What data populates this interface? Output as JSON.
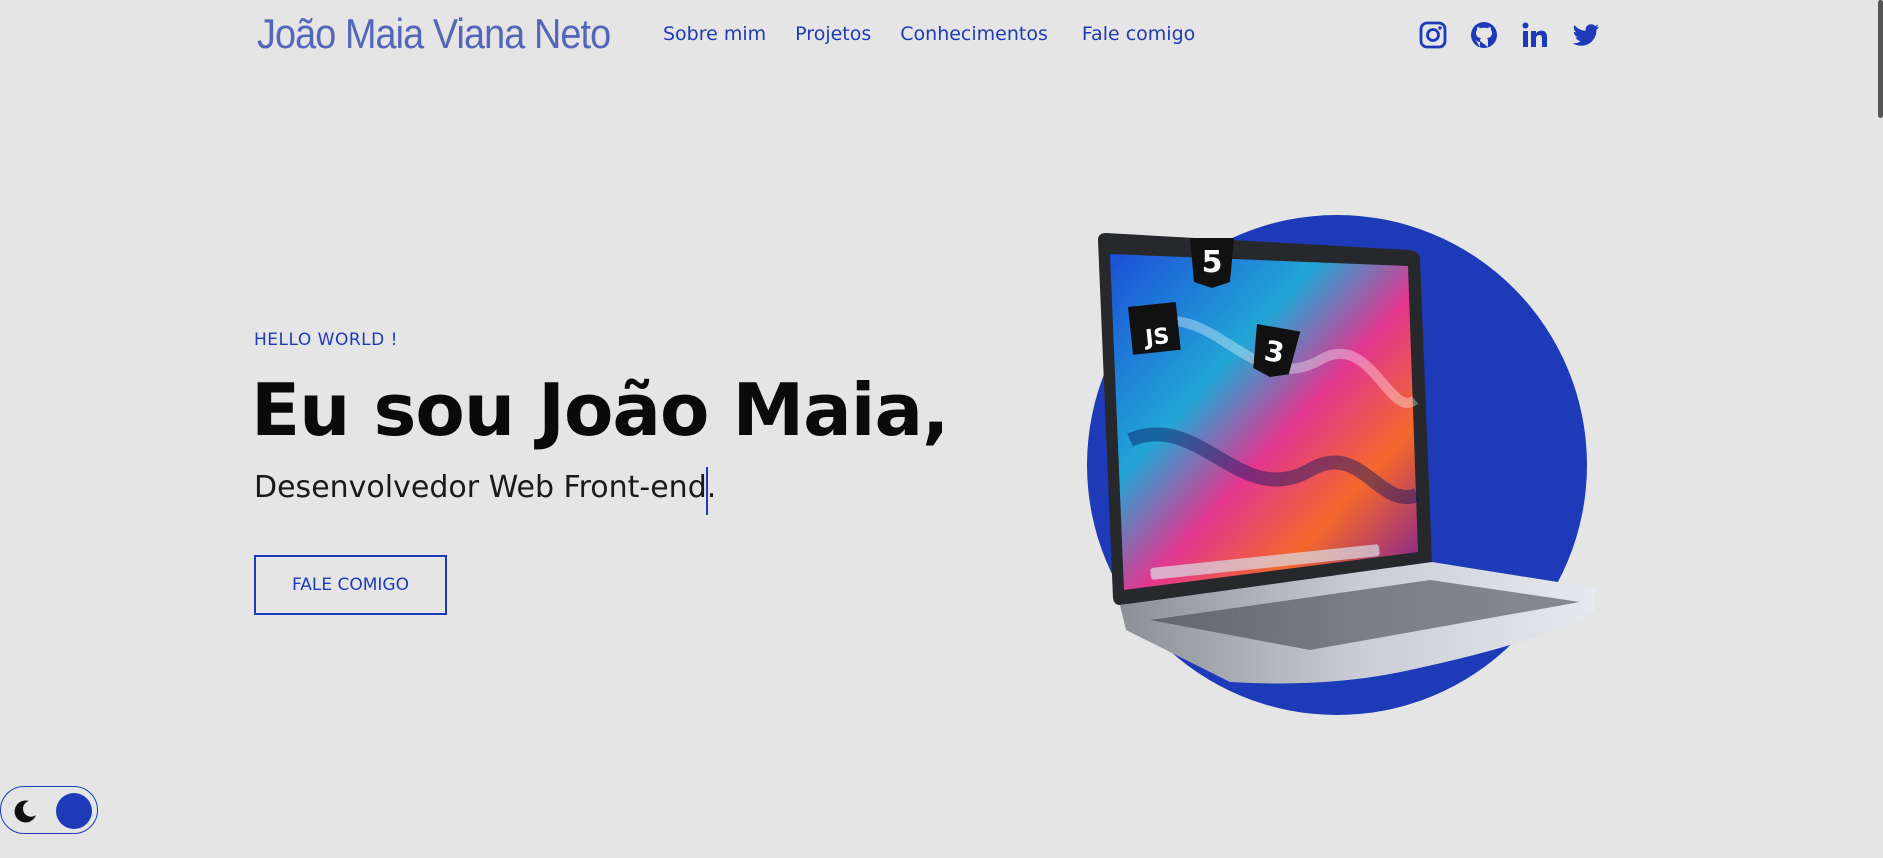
{
  "header": {
    "logo": "João Maia Viana Neto",
    "nav": [
      "Sobre mim",
      "Projetos",
      "Conhecimentos",
      "Fale comigo"
    ],
    "social_icons": [
      "instagram-icon",
      "github-icon",
      "linkedin-icon",
      "twitter-icon"
    ]
  },
  "hero": {
    "kicker": "HELLO WORLD !",
    "title": "Eu sou João Maia,",
    "subtitle": "Desenvolvedor Web Front-end.",
    "cta_label": "FALE COMIGO",
    "badges": [
      "5",
      "JS",
      "3"
    ]
  },
  "theme_toggle": {
    "icon": "moon-icon"
  },
  "colors": {
    "background": "#e5e5e5",
    "accent": "#1d3bb8",
    "logo": "#5466b9",
    "text": "#0a0a0a"
  }
}
